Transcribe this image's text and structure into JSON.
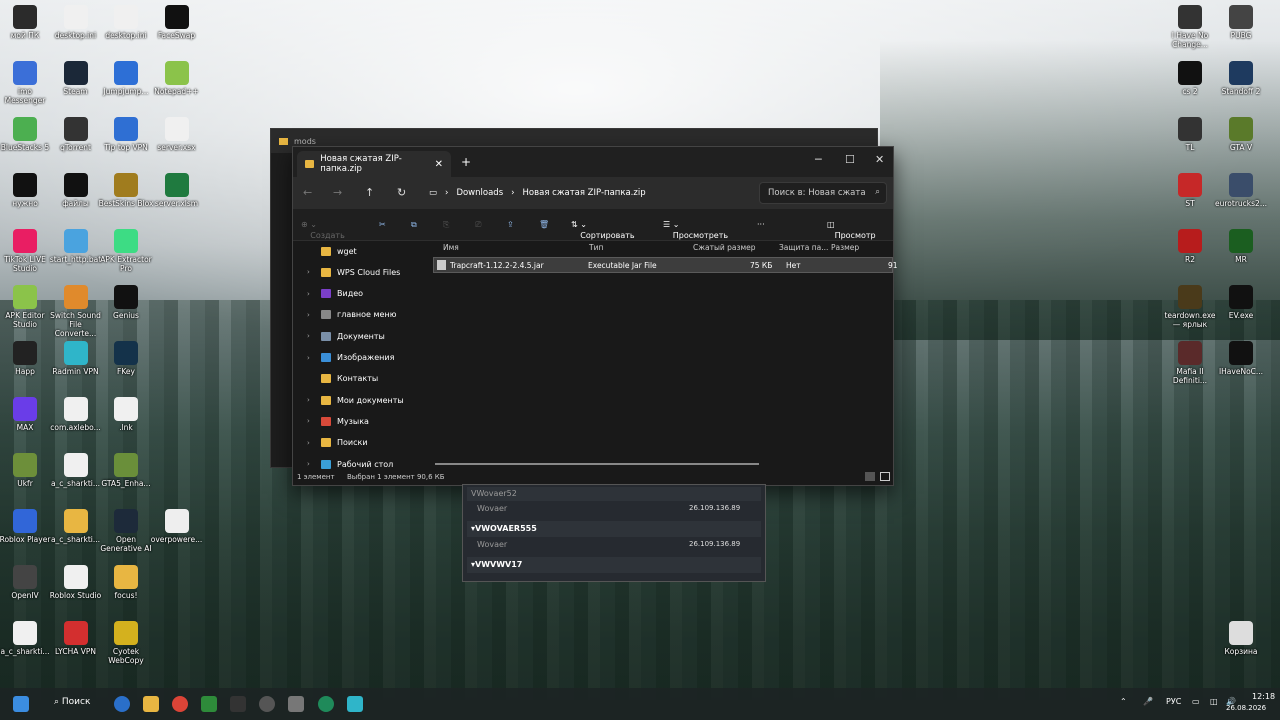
{
  "desktop_left": [
    {
      "label": "мой ПК",
      "icon": "monitor-icon",
      "color": "#2b2b2b"
    },
    {
      "label": "desktop.ini",
      "icon": "file-icon",
      "color": "#f0f0f0"
    },
    {
      "label": "desktop.ini",
      "icon": "file-icon",
      "color": "#f0f0f0"
    },
    {
      "label": "FaceSwap",
      "icon": "faceswap-icon",
      "color": "#111111"
    },
    {
      "label": "imo Messenger",
      "icon": "imo-icon",
      "color": "#3b6fd8"
    },
    {
      "label": "Steam",
      "icon": "steam-icon",
      "color": "#1b2838"
    },
    {
      "label": "Jumpjump...",
      "icon": "jump-icon",
      "color": "#2d6fd6"
    },
    {
      "label": "Notepad++",
      "icon": "notepad-icon",
      "color": "#8bc34a"
    },
    {
      "label": "BlueStacks 5",
      "icon": "bluestacks-icon",
      "color": "#4caf50"
    },
    {
      "label": "qTorrent",
      "icon": "torrent-icon",
      "color": "#333333"
    },
    {
      "label": "Tip top VPN",
      "icon": "shield-icon",
      "color": "#2f6fd3"
    },
    {
      "label": "server.xsx",
      "icon": "file-icon",
      "color": "#f0f0f0"
    },
    {
      "label": "нужно",
      "icon": "list-icon",
      "color": "#111111"
    },
    {
      "label": "файлы",
      "icon": "list-icon",
      "color": "#111111"
    },
    {
      "label": "BestSkins Blox",
      "icon": "skins-icon",
      "color": "#a07c1e"
    },
    {
      "label": "server.xlsm",
      "icon": "excel-icon",
      "color": "#1f7a3f"
    },
    {
      "label": "TikTok LIVE Studio",
      "icon": "tiktok-icon",
      "color": "#e91e63"
    },
    {
      "label": "start_http.bat",
      "icon": "bat-icon",
      "color": "#4aa3df"
    },
    {
      "label": "APK Extractor Pro",
      "icon": "apk-icon",
      "color": "#3ddc84"
    },
    {
      "label": "",
      "icon": "blank-icon",
      "color": "transparent"
    },
    {
      "label": "APK Editor Studio",
      "icon": "apk-editor-icon",
      "color": "#8bc34a"
    },
    {
      "label": "Switch Sound File Converte...",
      "icon": "switch-icon",
      "color": "#e08a2c"
    },
    {
      "label": "Genius",
      "icon": "genius-icon",
      "color": "#111111"
    },
    {
      "label": "",
      "icon": "blank-icon",
      "color": "transparent"
    },
    {
      "label": "Happ",
      "icon": "happ-icon",
      "color": "#222222"
    },
    {
      "label": "Radmin VPN",
      "icon": "radmin-icon",
      "color": "#2fb5c9"
    },
    {
      "label": "FKey",
      "icon": "fkey-icon",
      "color": "#14324a"
    },
    {
      "label": "",
      "icon": "blank-icon",
      "color": "transparent"
    },
    {
      "label": "MAX",
      "icon": "max-icon",
      "color": "#6a3de8"
    },
    {
      "label": "com.axlebo...",
      "icon": "file-icon",
      "color": "#f0f0f0"
    },
    {
      "label": ".lnk",
      "icon": "file-icon",
      "color": "#f0f0f0"
    },
    {
      "label": "",
      "icon": "blank-icon",
      "color": "transparent"
    },
    {
      "label": "Ukfr",
      "icon": "ukfr-icon",
      "color": "#6d8f3a"
    },
    {
      "label": "a_c_sharkti...",
      "icon": "file-icon",
      "color": "#f0f0f0"
    },
    {
      "label": "GTA5_Enha...",
      "icon": "gta-icon",
      "color": "#6a8f3a"
    },
    {
      "label": "",
      "icon": "blank-icon",
      "color": "transparent"
    },
    {
      "label": "Roblox Player",
      "icon": "roblox-icon",
      "color": "#3166d8"
    },
    {
      "label": "a_c_sharkti...",
      "icon": "folder-icon",
      "color": "#e8b642"
    },
    {
      "label": "Open Generative AI",
      "icon": "ai-icon",
      "color": "#1d2a3a"
    },
    {
      "label": "overpowere...",
      "icon": "java-icon",
      "color": "#eeeeee"
    },
    {
      "label": "OpenIV",
      "icon": "openiv-icon",
      "color": "#444444"
    },
    {
      "label": "Roblox Studio",
      "icon": "roblox-studio-icon",
      "color": "#f0f0f0"
    },
    {
      "label": "focus!",
      "icon": "folder-icon",
      "color": "#e8b642"
    },
    {
      "label": "",
      "icon": "blank-icon",
      "color": "transparent"
    },
    {
      "label": "a_c_sharkti...",
      "icon": "file-icon",
      "color": "#f0f0f0"
    },
    {
      "label": "LYCHA VPN",
      "icon": "lycha-icon",
      "color": "#d32f2f"
    },
    {
      "label": "Cyotek WebCopy",
      "icon": "webcopy-icon",
      "color": "#d4b11e"
    }
  ],
  "desktop_right": [
    {
      "label": "I Have No Change...",
      "icon": "game-icon",
      "color": "#333333"
    },
    {
      "label": "PUBG",
      "icon": "pubg-icon",
      "color": "#444444"
    },
    {
      "label": "cs 2",
      "icon": "cs2-icon",
      "color": "#111111"
    },
    {
      "label": "Standoff 2",
      "icon": "standoff-icon",
      "color": "#1e3a5f"
    },
    {
      "label": "TL",
      "icon": "tl-icon",
      "color": "#333333"
    },
    {
      "label": "GTA V",
      "icon": "gta-v-icon",
      "color": "#5a7a2a"
    },
    {
      "label": "ST",
      "icon": "st-icon",
      "color": "#c62828"
    },
    {
      "label": "eurotrucks2...",
      "icon": "truck-icon",
      "color": "#3a4d6a"
    },
    {
      "label": "R2",
      "icon": "r2-icon",
      "color": "#b71c1c"
    },
    {
      "label": "MR",
      "icon": "mr-icon",
      "color": "#1b5e20"
    },
    {
      "label": "teardown.exe — ярлык",
      "icon": "teardown-icon",
      "color": "#4a3a1a"
    },
    {
      "label": "EV.exe",
      "icon": "unreal-icon",
      "color": "#111111"
    },
    {
      "label": "Mafia II Definiti...",
      "icon": "mafia-icon",
      "color": "#5a2a2a"
    },
    {
      "label": "IHaveNoC...",
      "icon": "unreal-icon",
      "color": "#111111"
    },
    {
      "label": "Корзина",
      "icon": "recycle-bin-icon",
      "color": "#dddddd"
    }
  ],
  "back_window": {
    "title": "mods"
  },
  "explorer": {
    "tab_title": "Новая сжатая ZIP-папка.zip",
    "breadcrumb": [
      "Downloads",
      "Новая сжатая ZIP-папка.zip"
    ],
    "search_placeholder": "Поиск в: Новая сжата",
    "toolbar": {
      "create": "Создать",
      "sort": "Сортировать",
      "view": "Просмотреть",
      "more": "···",
      "preview": "Просмотр"
    },
    "sidebar": [
      {
        "label": "wget",
        "color": "#e8b642",
        "arrow": ""
      },
      {
        "label": "WPS Cloud Files",
        "color": "#e8b642",
        "arrow": "›"
      },
      {
        "label": "Видео",
        "color": "#7b3fc9",
        "arrow": "›"
      },
      {
        "label": "главное меню",
        "color": "#888888",
        "arrow": "›"
      },
      {
        "label": "Документы",
        "color": "#7a8fa8",
        "arrow": "›"
      },
      {
        "label": "Изображения",
        "color": "#3a8fd8",
        "arrow": "›"
      },
      {
        "label": "Контакты",
        "color": "#e8b642",
        "arrow": ""
      },
      {
        "label": "Мои документы",
        "color": "#e8b642",
        "arrow": "›"
      },
      {
        "label": "Музыка",
        "color": "#d84a3a",
        "arrow": "›"
      },
      {
        "label": "Поиски",
        "color": "#e8b642",
        "arrow": "›"
      },
      {
        "label": "Рабочий стол",
        "color": "#3a9fd8",
        "arrow": "›"
      }
    ],
    "columns": {
      "name": "Имя",
      "type": "Тип",
      "packed": "Сжатый размер",
      "protected": "Защита па...",
      "size": "Размер"
    },
    "files": [
      {
        "name": "Trapcraft-1.12.2-2.4.5.jar",
        "type": "Executable Jar File",
        "packed": "75 КБ",
        "protected": "Нет",
        "size": "91"
      }
    ],
    "status": {
      "count": "1 элемент",
      "selected": "Выбран 1 элемент 90,6 КБ"
    }
  },
  "vpn_panel": {
    "groups": [
      {
        "name": "VWovaer52",
        "member": "Wovaer",
        "ip": "26.109.136.89"
      },
      {
        "name": "VWOVAER555",
        "member": "Wovaer",
        "ip": "26.109.136.89"
      },
      {
        "name": "VWVWV17",
        "member": "",
        "ip": ""
      }
    ]
  },
  "taskbar": {
    "search": "Поиск",
    "lang": "РУС",
    "time": "12:18",
    "date": "26.08.2026"
  }
}
